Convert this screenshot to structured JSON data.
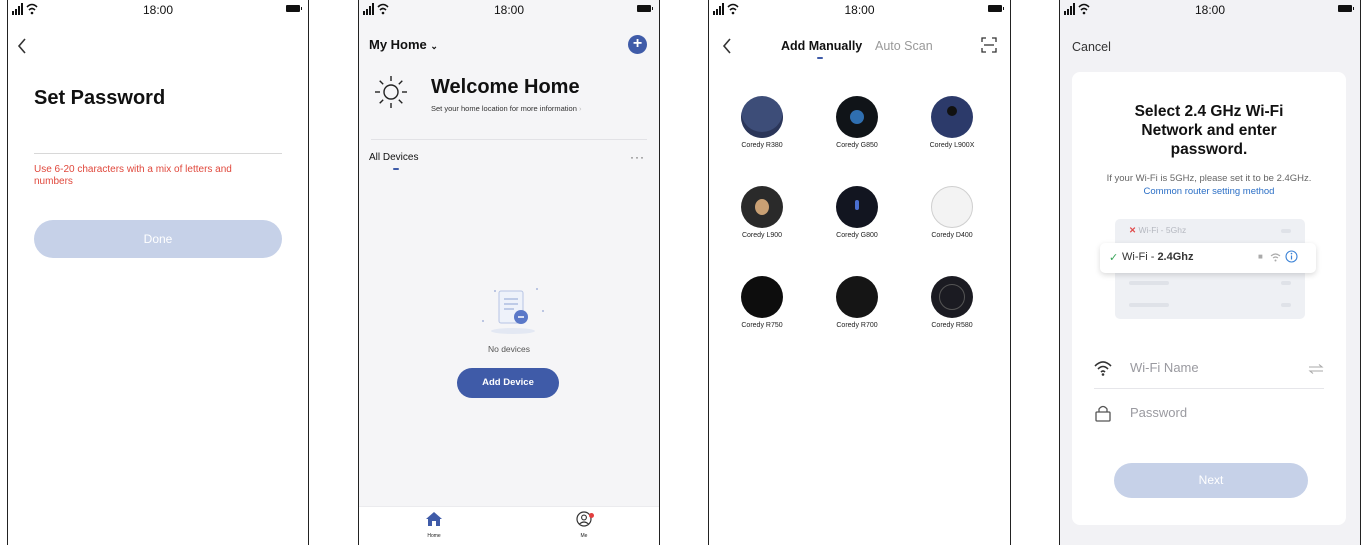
{
  "status_time": "18:00",
  "screen_password": {
    "title": "Set Password",
    "hint": "Use 6-20 characters with a mix of letters and numbers",
    "done_label": "Done"
  },
  "screen_home": {
    "home_name": "My Home",
    "welcome_title": "Welcome Home",
    "welcome_sub": "Set your home location for more information",
    "all_devices": "All Devices",
    "empty_text": "No devices",
    "add_device_label": "Add Device",
    "tabs": [
      {
        "label": "Home",
        "icon": "home-icon"
      },
      {
        "label": "Me",
        "icon": "profile-icon"
      }
    ]
  },
  "screen_add": {
    "tab_manual": "Add Manually",
    "tab_scan": "Auto Scan",
    "robots": [
      {
        "name": "Coredy R380",
        "color": "#3d4d78"
      },
      {
        "name": "Coredy G850",
        "color": "#101418"
      },
      {
        "name": "Coredy L900X",
        "color": "#2c3a6a"
      },
      {
        "name": "Coredy L900",
        "color": "#2a2a2a"
      },
      {
        "name": "Coredy G800",
        "color": "#121520"
      },
      {
        "name": "Coredy D400",
        "color": "#f3f3f3"
      },
      {
        "name": "Coredy R750",
        "color": "#0d0d0d"
      },
      {
        "name": "Coredy R700",
        "color": "#151515"
      },
      {
        "name": "Coredy R580",
        "color": "#1b1b22"
      }
    ]
  },
  "screen_wifi": {
    "cancel_label": "Cancel",
    "title": "Select 2.4 GHz Wi-Fi Network and enter password.",
    "note": "If your Wi-Fi is 5GHz, please set it to be 2.4GHz.",
    "note_link": "Common router setting method",
    "wifi_5g": "Wi-Fi - 5Ghz",
    "wifi_24_prefix": "Wi-Fi - ",
    "wifi_24_band": "2.4Ghz",
    "wifi_name_placeholder": "Wi-Fi Name",
    "password_placeholder": "Password",
    "next_label": "Next"
  }
}
